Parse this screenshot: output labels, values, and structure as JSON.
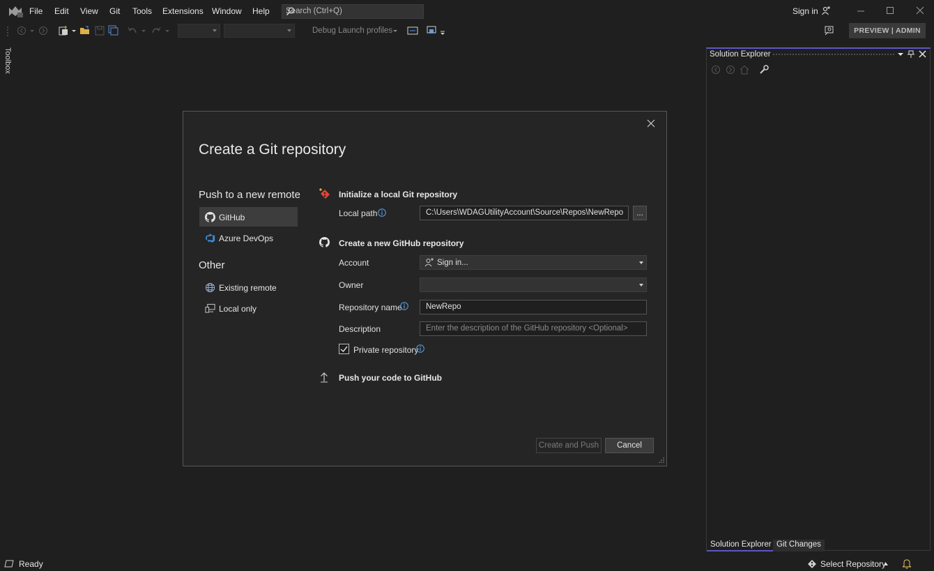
{
  "menu": {
    "items": [
      "File",
      "Edit",
      "View",
      "Git",
      "Tools",
      "Extensions",
      "Window",
      "Help"
    ],
    "search_placeholder": "Search (Ctrl+Q)",
    "sign_in": "Sign in"
  },
  "toolbar": {
    "debug_label": "Debug Launch profiles",
    "preview_button": "PREVIEW | ADMIN"
  },
  "toolbox": {
    "label": "Toolbox"
  },
  "solution_explorer": {
    "title": "Solution Explorer",
    "bottom_tabs": [
      "Solution Explorer",
      "Git Changes"
    ]
  },
  "status_bar": {
    "ready": "Ready",
    "select_repository": "Select Repository"
  },
  "dialog": {
    "title": "Create a Git repository",
    "left_nav": {
      "push_header": "Push to a new remote",
      "push_items": [
        {
          "label": "GitHub",
          "icon": "github-icon",
          "selected": true
        },
        {
          "label": "Azure DevOps",
          "icon": "azure-devops-icon",
          "selected": false
        }
      ],
      "other_header": "Other",
      "other_items": [
        {
          "label": "Existing remote",
          "icon": "globe-icon"
        },
        {
          "label": "Local only",
          "icon": "computer-icon"
        }
      ]
    },
    "init_section": {
      "header": "Initialize a local Git repository",
      "local_path_label": "Local path",
      "local_path_value": "C:\\Users\\WDAGUtilityAccount\\Source\\Repos\\NewRepo",
      "browse_button": "..."
    },
    "github_section": {
      "header": "Create a new GitHub repository",
      "account_label": "Account",
      "account_value": "Sign in...",
      "owner_label": "Owner",
      "owner_value": "",
      "repo_name_label": "Repository name",
      "repo_name_value": "NewRepo",
      "description_label": "Description",
      "description_placeholder": "Enter the description of the GitHub repository <Optional>",
      "private_label": "Private repository",
      "private_checked": true
    },
    "push_section": {
      "header": "Push your code to GitHub"
    },
    "buttons": {
      "create_push": "Create and Push",
      "cancel": "Cancel"
    }
  },
  "colors": {
    "accent": "#5e56c6",
    "background": "#1f1f1f",
    "dialog_bg": "#252525"
  }
}
